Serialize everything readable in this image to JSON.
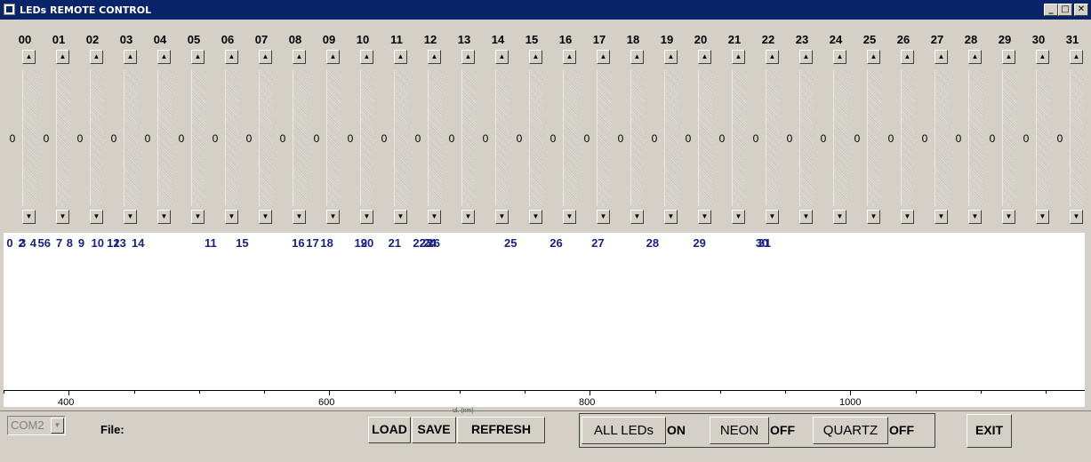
{
  "window": {
    "title": "LEDs REMOTE CONTROL",
    "minimize_glyph": "_",
    "maximize_glyph": "□",
    "close_glyph": "✕"
  },
  "channels": [
    {
      "label": "00",
      "value": "0"
    },
    {
      "label": "01",
      "value": "0"
    },
    {
      "label": "02",
      "value": "0"
    },
    {
      "label": "03",
      "value": "0"
    },
    {
      "label": "04",
      "value": "0"
    },
    {
      "label": "05",
      "value": "0"
    },
    {
      "label": "06",
      "value": "0"
    },
    {
      "label": "07",
      "value": "0"
    },
    {
      "label": "08",
      "value": "0"
    },
    {
      "label": "09",
      "value": "0"
    },
    {
      "label": "10",
      "value": "0"
    },
    {
      "label": "11",
      "value": "0"
    },
    {
      "label": "12",
      "value": "0"
    },
    {
      "label": "13",
      "value": "0"
    },
    {
      "label": "14",
      "value": "0"
    },
    {
      "label": "15",
      "value": "0"
    },
    {
      "label": "16",
      "value": "0"
    },
    {
      "label": "17",
      "value": "0"
    },
    {
      "label": "18",
      "value": "0"
    },
    {
      "label": "19",
      "value": "0"
    },
    {
      "label": "20",
      "value": "0"
    },
    {
      "label": "21",
      "value": "0"
    },
    {
      "label": "22",
      "value": "0"
    },
    {
      "label": "23",
      "value": "0"
    },
    {
      "label": "24",
      "value": "0"
    },
    {
      "label": "25",
      "value": "0"
    },
    {
      "label": "26",
      "value": "0"
    },
    {
      "label": "27",
      "value": "0"
    },
    {
      "label": "28",
      "value": "0"
    },
    {
      "label": "29",
      "value": "0"
    },
    {
      "label": "30",
      "value": "0"
    },
    {
      "label": "31",
      "value": "0"
    }
  ],
  "slider_glyphs": {
    "up": "▲",
    "down": "▼"
  },
  "led_markers": [
    {
      "label": "0",
      "pos": 355
    },
    {
      "label": "2",
      "pos": 364
    },
    {
      "label": "3",
      "pos": 365
    },
    {
      "label": "4",
      "pos": 373
    },
    {
      "label": "5",
      "pos": 379
    },
    {
      "label": "6",
      "pos": 384
    },
    {
      "label": "7",
      "pos": 393
    },
    {
      "label": "8",
      "pos": 401
    },
    {
      "label": "9",
      "pos": 410
    },
    {
      "label": "10",
      "pos": 420
    },
    {
      "label": "12",
      "pos": 432
    },
    {
      "label": "13",
      "pos": 437
    },
    {
      "label": "14",
      "pos": 451
    },
    {
      "label": "11",
      "pos": 507
    },
    {
      "label": "15",
      "pos": 531
    },
    {
      "label": "16",
      "pos": 574
    },
    {
      "label": "17",
      "pos": 585
    },
    {
      "label": "18",
      "pos": 596
    },
    {
      "label": "19",
      "pos": 622
    },
    {
      "label": "20",
      "pos": 627
    },
    {
      "label": "21",
      "pos": 648
    },
    {
      "label": "22",
      "pos": 667
    },
    {
      "label": "23",
      "pos": 672
    },
    {
      "label": "24",
      "pos": 675
    },
    {
      "label": "26",
      "pos": 678
    },
    {
      "label": "25",
      "pos": 737
    },
    {
      "label": "26",
      "pos": 772
    },
    {
      "label": "27",
      "pos": 804
    },
    {
      "label": "28",
      "pos": 846
    },
    {
      "label": "29",
      "pos": 882
    },
    {
      "label": "30",
      "pos": 930
    },
    {
      "label": "31",
      "pos": 932
    }
  ],
  "axis": {
    "min": 350,
    "max": 1180,
    "major_ticks": [
      {
        "label": "400",
        "value": 400
      },
      {
        "label": "600",
        "value": 600
      },
      {
        "label": "800",
        "value": 800
      },
      {
        "label": "1000",
        "value": 1000
      }
    ],
    "minor_ticks": [
      350,
      450,
      500,
      550,
      650,
      700,
      750,
      850,
      900,
      950,
      1050,
      1100,
      1150
    ],
    "title": "ul. (nm)"
  },
  "port": {
    "value": "COM2",
    "arrow": "▼"
  },
  "file_label": "File:",
  "buttons": {
    "load": "LOAD",
    "save": "SAVE",
    "refresh": "REFRESH",
    "exit": "EXIT"
  },
  "toggles": {
    "all_leds": {
      "label": "ALL LEDs",
      "state": "ON"
    },
    "neon": {
      "label": "NEON",
      "state": "OFF"
    },
    "quartz": {
      "label": "QUARTZ",
      "state": "OFF"
    }
  }
}
